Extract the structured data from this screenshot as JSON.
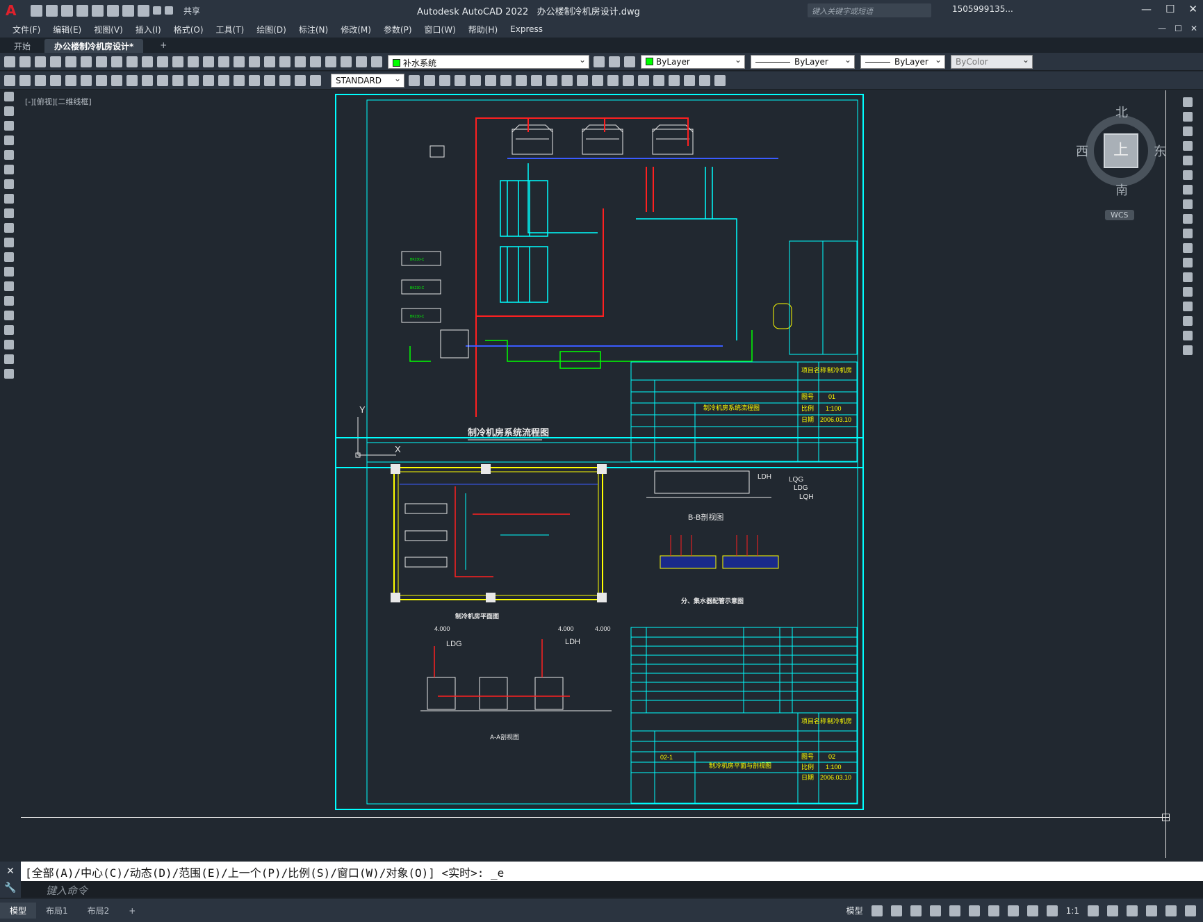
{
  "app": {
    "logo": "A",
    "title": "Autodesk AutoCAD 2022",
    "file": "办公楼制冷机房设计.dwg"
  },
  "quick_access": {
    "share_label": "共享"
  },
  "search": {
    "placeholder": "键入关键字或短语"
  },
  "user": {
    "name": "1505999135..."
  },
  "window_controls": {
    "minimize": "—",
    "restore": "☐",
    "close": "✕"
  },
  "menu": [
    "文件(F)",
    "编辑(E)",
    "视图(V)",
    "插入(I)",
    "格式(O)",
    "工具(T)",
    "绘图(D)",
    "标注(N)",
    "修改(M)",
    "参数(P)",
    "窗口(W)",
    "帮助(H)",
    "Express"
  ],
  "doc_tabs": [
    {
      "label": "开始",
      "active": false
    },
    {
      "label": "办公楼制冷机房设计*",
      "active": true
    }
  ],
  "toolbar1": {
    "layer": "补水系统",
    "color": "ByLayer",
    "linetype": "ByLayer",
    "lineweight": "ByLayer",
    "plotstyle": "ByColor"
  },
  "toolbar2": {
    "text_style": "STANDARD"
  },
  "viewport": {
    "label": "[-][俯视][二维线框]"
  },
  "viewcube": {
    "north": "北",
    "south": "南",
    "east": "东",
    "west": "西",
    "face": "上",
    "wcs": "WCS"
  },
  "drawing": {
    "sheet1": {
      "title": "制冷机房系统流程图",
      "titleblock": {
        "project_label": "项目名称",
        "project": "制冷机房",
        "sheet_name": "制冷机房系统流程图",
        "no_label": "图号",
        "no": "01",
        "scale_label": "比例",
        "scale": "1:100",
        "date_label": "日期",
        "date": "2006.03.10"
      }
    },
    "sheet2": {
      "plan_title": "制冷机房平面图",
      "section_bb": "B-B剖视图",
      "section_aa": "A-A剖视图",
      "manifold_title": "分、集水器配管示意图",
      "labels": {
        "ldh": "LDH",
        "ldg": "LDG",
        "lqg": "LQG",
        "lqh": "LQH",
        "elev1": "4.000",
        "elev2": "4.000",
        "elev3": "4.000"
      },
      "titleblock": {
        "project_label": "项目名称",
        "project": "制冷机房",
        "drawing_no": "02-1",
        "sheet_name": "制冷机房平面与剖视图",
        "no_label": "图号",
        "no": "02",
        "scale_label": "比例",
        "scale": "1:100",
        "date_label": "日期",
        "date": "2006.03.10"
      }
    }
  },
  "command": {
    "history": "[全部(A)/中心(C)/动态(D)/范围(E)/上一个(P)/比例(S)/窗口(W)/对象(O)] <实时>: _e",
    "placeholder": "键入命令"
  },
  "status": {
    "layouts": [
      "模型",
      "布局1",
      "布局2"
    ],
    "model_label": "模型",
    "scale": "1:1"
  },
  "colors": {
    "cyan": "#00ffff",
    "red": "#ff2020",
    "yellow": "#ffff00",
    "green": "#00ff00",
    "blue": "#3a5bff",
    "white": "#e8e8e8",
    "magenta": "#ff00ff"
  }
}
